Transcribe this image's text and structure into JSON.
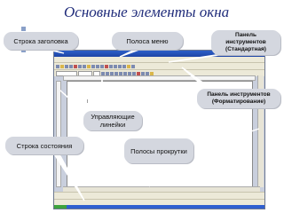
{
  "slide": {
    "title": "Основные элементы окна"
  },
  "callouts": {
    "title_bar": "Строка заголовка",
    "menu_bar": "Полоса меню",
    "standard_toolbar": [
      "Панель",
      "инструментов",
      "(Стандартная)"
    ],
    "formatting_toolbar": [
      "Панель инструментов",
      "(Форматирование)"
    ],
    "rulers": [
      "Управляющие",
      "линейки"
    ],
    "status_bar": "Строка состояния",
    "scrollbars": "Полосы прокрутки"
  },
  "colors": {
    "title": "#1f2b7a",
    "callout_bg": "#d4d7df",
    "bullet": "#8aa0c8",
    "pointer": "#ffffff"
  },
  "icons": [
    "bullet-square-icon",
    "window-close-icon",
    "window-maximize-icon",
    "window-minimize-icon"
  ]
}
